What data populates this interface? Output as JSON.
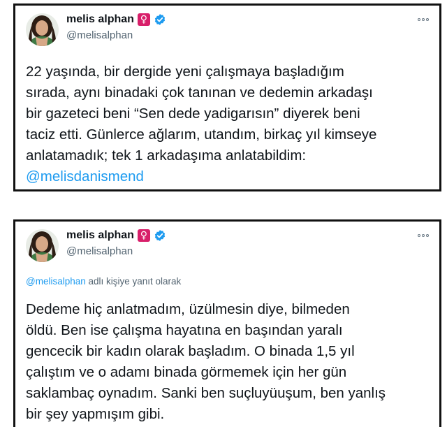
{
  "tweets": [
    {
      "author": {
        "name": "melis alphan",
        "badge_symbol": "♀",
        "handle": "@melisalphan"
      },
      "text": "22 yaşında, bir dergide yeni çalışmaya başladığım\nsırada, aynı binadaki çok tanınan ve dedemin arkadaşı\nbir gazeteci beni “Sen dede yadigarısın” diyerek beni\ntaciz etti. Günlerce ağlarım, utandım, birkaç yıl kimseye\nanlatamadık; tek 1 arkadaşıma anlatabildim:",
      "mention": "@melisdanismend"
    },
    {
      "author": {
        "name": "melis alphan",
        "badge_symbol": "♀",
        "handle": "@melisalphan"
      },
      "reply_to_handle": "@melisalphan",
      "reply_suffix": " adlı kişiye yanıt olarak",
      "text": "Dedeme hiç anlatmadım, üzülmesin diye, bilmeden\nöldü. Ben ise çalışma hayatına en başından yaralı\ngencecik bir kadın olarak başladım. O binada 1,5 yıl\nçalıştım ve o adamı binada görmemek için her gün\nsaklambaç oynadım. Sanki ben suçluyüuşum, ben yanlış\nbir şey yapmışım gibi."
    }
  ],
  "colors": {
    "link": "#1d9bf0",
    "verified": "#1d9bf0",
    "venus_badge": "#d81f6a",
    "secondary_text": "#536471",
    "card_border": "#111111"
  },
  "icons": [
    "avatar",
    "venus-badge-icon",
    "verified-icon",
    "more-options-icon"
  ]
}
